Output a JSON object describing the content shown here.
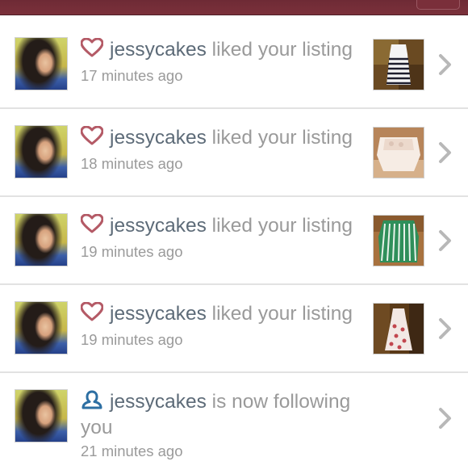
{
  "colors": {
    "header": "#7b313b",
    "heart": "#b45a66",
    "follow": "#2d6fa3",
    "username": "#5d6b78",
    "muted": "#9a9a9a"
  },
  "notifications": [
    {
      "username": "jessycakes",
      "action": "liked your listing",
      "time": "17 minutes ago",
      "icon": "heart-icon",
      "listing": "striped dress"
    },
    {
      "username": "jessycakes",
      "action": "liked your listing",
      "time": "18 minutes ago",
      "icon": "heart-icon",
      "listing": "cream lace top"
    },
    {
      "username": "jessycakes",
      "action": "liked your listing",
      "time": "19 minutes ago",
      "icon": "heart-icon",
      "listing": "green striped shirt"
    },
    {
      "username": "jessycakes",
      "action": "liked your listing",
      "time": "19 minutes ago",
      "icon": "heart-icon",
      "listing": "floral dress"
    },
    {
      "username": "jessycakes",
      "action": "is now following you",
      "time": "21 minutes ago",
      "icon": "follow-icon"
    }
  ]
}
